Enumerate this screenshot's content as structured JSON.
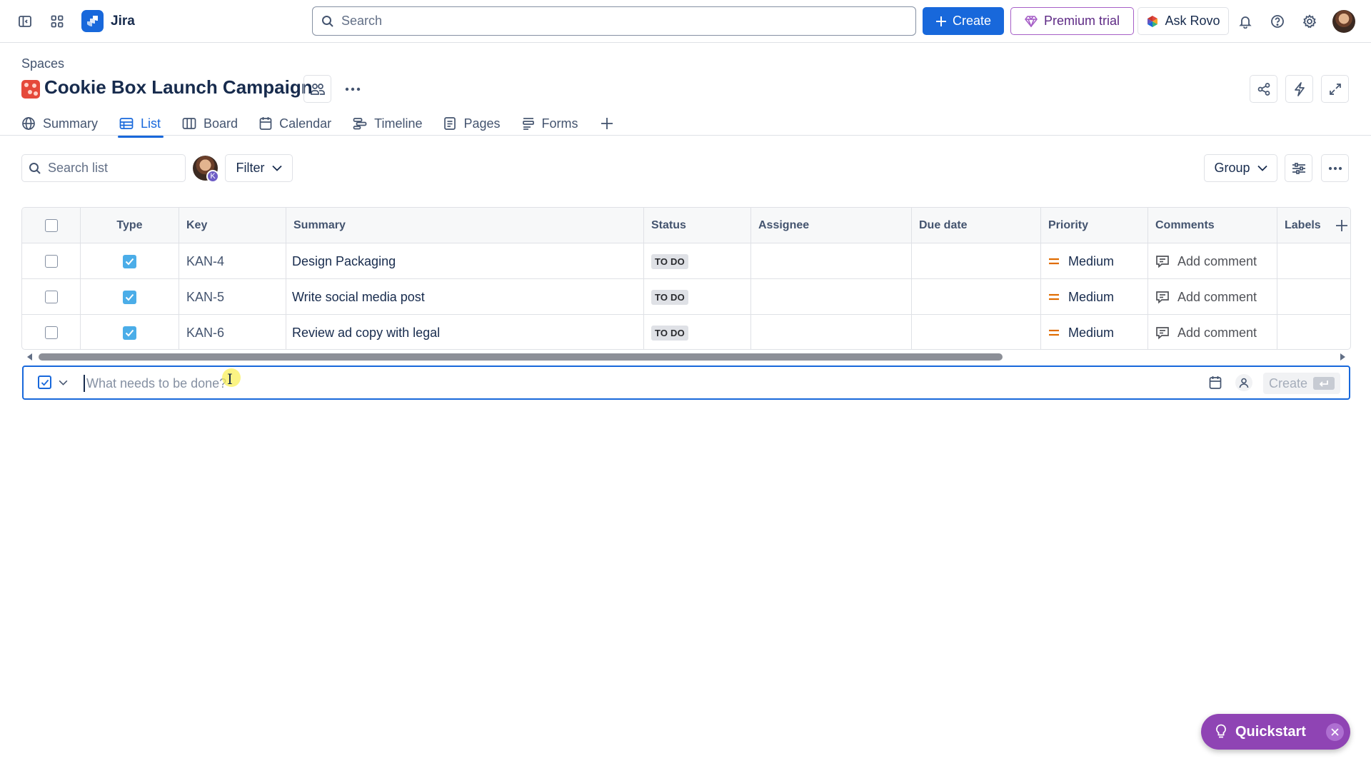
{
  "app": {
    "name": "Jira",
    "search_placeholder": "Search",
    "create_label": "Create",
    "premium_label": "Premium trial",
    "rovo_label": "Ask Rovo",
    "accent": "#1868db",
    "premium_color": "#a65fc7"
  },
  "header": {
    "breadcrumb": "Spaces",
    "title": "Cookie Box Launch Campaign"
  },
  "tabs": [
    {
      "label": "Summary",
      "icon": "globe-icon",
      "active": false
    },
    {
      "label": "List",
      "icon": "list-icon",
      "active": true
    },
    {
      "label": "Board",
      "icon": "board-icon",
      "active": false
    },
    {
      "label": "Calendar",
      "icon": "calendar-icon",
      "active": false
    },
    {
      "label": "Timeline",
      "icon": "timeline-icon",
      "active": false
    },
    {
      "label": "Pages",
      "icon": "pages-icon",
      "active": false
    },
    {
      "label": "Forms",
      "icon": "forms-icon",
      "active": false
    }
  ],
  "toolbar": {
    "search_placeholder": "Search list",
    "avatar_badge": "K",
    "filter_label": "Filter",
    "group_label": "Group"
  },
  "table": {
    "columns": [
      "Type",
      "Key",
      "Summary",
      "Status",
      "Assignee",
      "Due date",
      "Priority",
      "Comments",
      "Labels"
    ],
    "rows": [
      {
        "key": "KAN-4",
        "summary": "Design Packaging",
        "status": "TO DO",
        "assignee": "",
        "due": "",
        "priority": "Medium",
        "comments": "Add comment",
        "labels": ""
      },
      {
        "key": "KAN-5",
        "summary": "Write social media post",
        "status": "TO DO",
        "assignee": "",
        "due": "",
        "priority": "Medium",
        "comments": "Add comment",
        "labels": ""
      },
      {
        "key": "KAN-6",
        "summary": "Review ad copy with legal",
        "status": "TO DO",
        "assignee": "",
        "due": "",
        "priority": "Medium",
        "comments": "Add comment",
        "labels": ""
      }
    ],
    "priority_color": "#e06c00"
  },
  "inline_create": {
    "placeholder": "What needs to be done?",
    "create_label": "Create"
  },
  "quickstart": {
    "label": "Quickstart",
    "color": "#8f44b4"
  }
}
